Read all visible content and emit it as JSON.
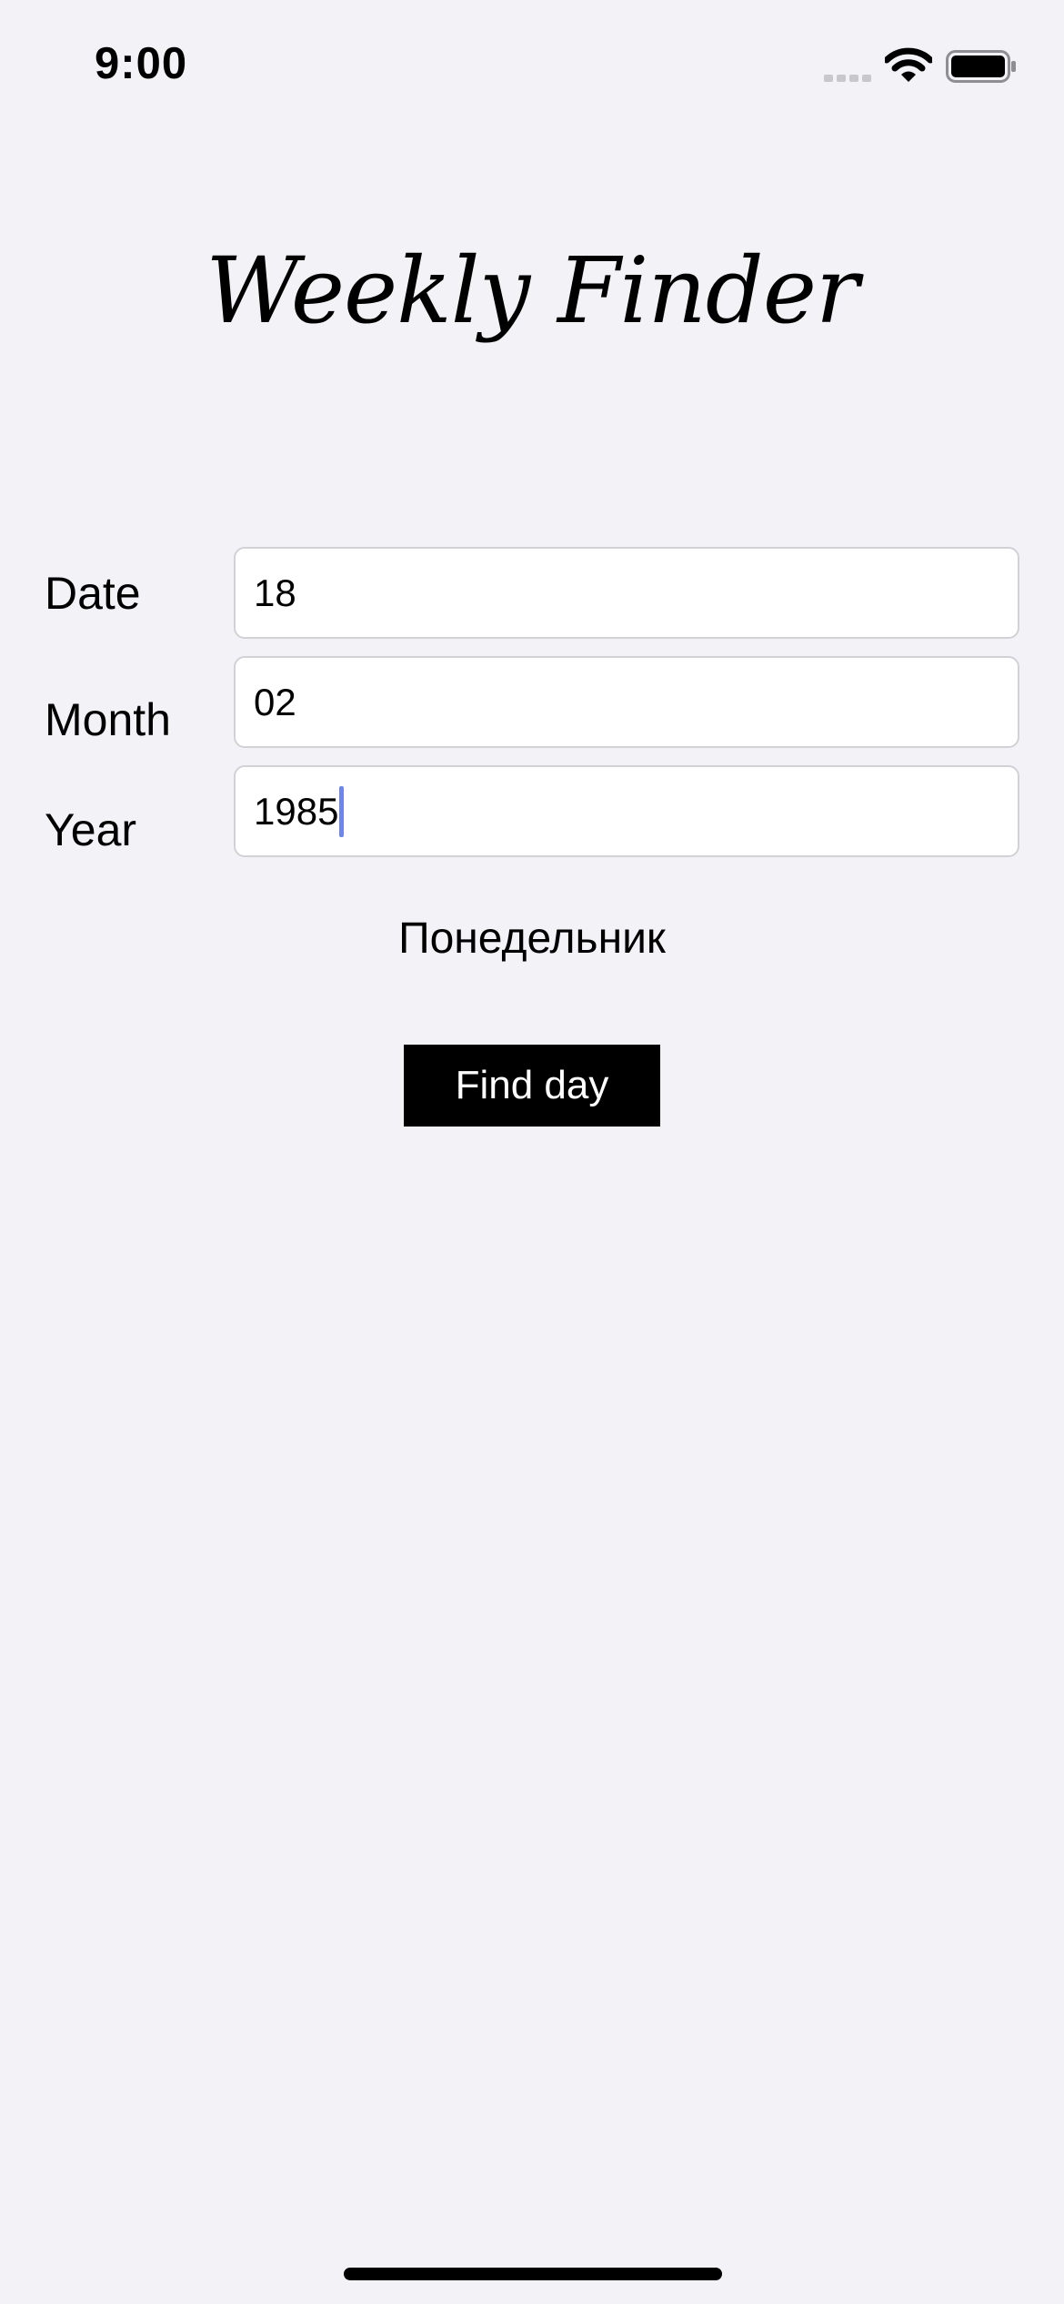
{
  "status_bar": {
    "time": "9:00",
    "icons": [
      "signal-icon",
      "wifi-icon",
      "battery-icon"
    ]
  },
  "app": {
    "title": "Weekly Finder"
  },
  "form": {
    "date_label": "Date",
    "date_value": "18",
    "month_label": "Month",
    "month_value": "02",
    "year_label": "Year",
    "year_value": "1985"
  },
  "result": {
    "weekday": "Понедельник"
  },
  "actions": {
    "find_label": "Find day"
  },
  "colors": {
    "background": "#f2f2f7",
    "button": "#000000",
    "caret": "#6e86ec"
  }
}
